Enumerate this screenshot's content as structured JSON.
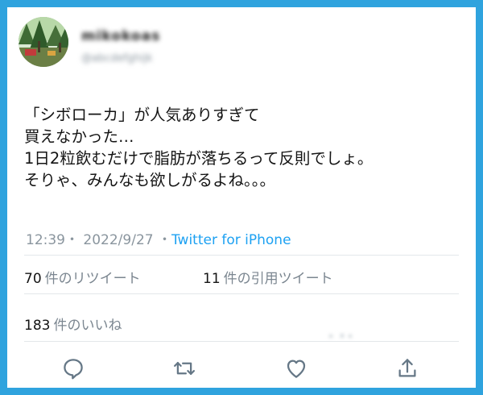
{
  "user": {
    "name": "mikokoas",
    "handle": "@abcdefghijk"
  },
  "tweet": {
    "lines": [
      "「シボローカ」が人気ありすぎて",
      "買えなかった…",
      "1日2粒飲むだけで脂肪が落ちるって反則でしょ。",
      "そりゃ、みんなも欲しがるよね。。。"
    ],
    "time": "12:39",
    "date": "2022/9/27",
    "separator": "・",
    "source": "Twitter for iPhone"
  },
  "stats": {
    "retweets": {
      "count": "70",
      "label": "件のリツイート"
    },
    "quotes": {
      "count": "11",
      "label": "件の引用ツイート"
    },
    "likes": {
      "count": "183",
      "label": "件のいいね"
    }
  },
  "actions": [
    "reply-icon",
    "retweet-icon",
    "like-icon",
    "share-icon"
  ],
  "colors": {
    "frame": "#2fa3de",
    "link": "#1da1f2",
    "muted": "#8a959e",
    "icon": "#657786"
  }
}
